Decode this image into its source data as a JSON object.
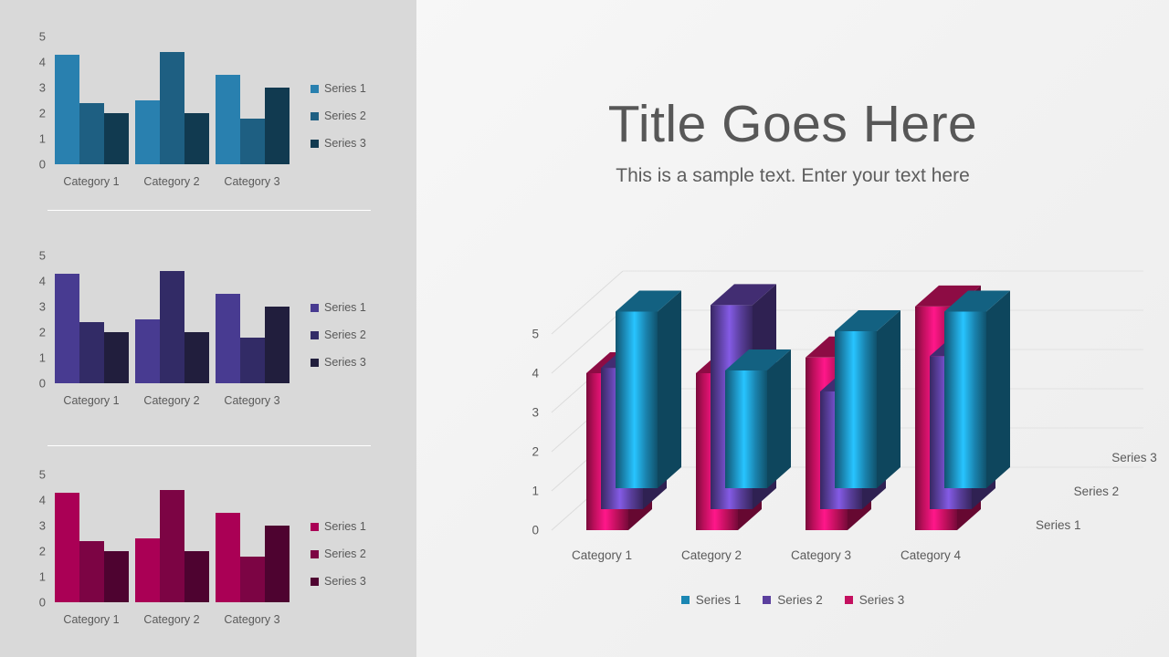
{
  "header": {
    "title": "Title Goes Here",
    "subtitle": "This is a sample text. Enter your text here"
  },
  "mini_charts": [
    {
      "id": "mini-chart-1",
      "palette": [
        "#2980af",
        "#1e5f82",
        "#113a50"
      ],
      "chart_data": {
        "type": "bar",
        "title": "",
        "xlabel": "",
        "ylabel": "",
        "ylim": [
          0,
          5
        ],
        "yticks": [
          "5",
          "4",
          "3",
          "2",
          "1",
          "0"
        ],
        "grid": false,
        "legend_position": "right",
        "categories": [
          "Category 1",
          "Category 2",
          "Category 3"
        ],
        "series": [
          {
            "name": "Series 1",
            "color": "#2980af",
            "values": [
              4.3,
              2.5,
              3.5
            ]
          },
          {
            "name": "Series 2",
            "color": "#1e5f82",
            "values": [
              2.4,
              4.4,
              1.8
            ]
          },
          {
            "name": "Series 3",
            "color": "#113a50",
            "values": [
              2.0,
              2.0,
              3.0
            ]
          }
        ]
      }
    },
    {
      "id": "mini-chart-2",
      "palette": [
        "#483b91",
        "#322b66",
        "#211e3d"
      ],
      "chart_data": {
        "type": "bar",
        "title": "",
        "xlabel": "",
        "ylabel": "",
        "ylim": [
          0,
          5
        ],
        "yticks": [
          "5",
          "4",
          "3",
          "2",
          "1",
          "0"
        ],
        "grid": false,
        "legend_position": "right",
        "categories": [
          "Category 1",
          "Category 2",
          "Category 3"
        ],
        "series": [
          {
            "name": "Series 1",
            "color": "#483b91",
            "values": [
              4.3,
              2.5,
              3.5
            ]
          },
          {
            "name": "Series 2",
            "color": "#322b66",
            "values": [
              2.4,
              4.4,
              1.8
            ]
          },
          {
            "name": "Series 3",
            "color": "#211e3d",
            "values": [
              2.0,
              2.0,
              3.0
            ]
          }
        ]
      }
    },
    {
      "id": "mini-chart-3",
      "palette": [
        "#aa0055",
        "#7c0444",
        "#4e0330"
      ],
      "chart_data": {
        "type": "bar",
        "title": "",
        "xlabel": "",
        "ylabel": "",
        "ylim": [
          0,
          5
        ],
        "yticks": [
          "5",
          "4",
          "3",
          "2",
          "1",
          "0"
        ],
        "grid": false,
        "legend_position": "right",
        "categories": [
          "Category 1",
          "Category 2",
          "Category 3"
        ],
        "series": [
          {
            "name": "Series 1",
            "color": "#aa0055",
            "values": [
              4.3,
              2.5,
              3.5
            ]
          },
          {
            "name": "Series 2",
            "color": "#7c0444",
            "values": [
              2.4,
              4.4,
              1.8
            ]
          },
          {
            "name": "Series 3",
            "color": "#4e0330",
            "values": [
              2.0,
              2.0,
              3.0
            ]
          }
        ]
      }
    }
  ],
  "chart_data": {
    "type": "bar",
    "render": "3d-column",
    "title": "",
    "xlabel": "",
    "ylabel": "",
    "ylim": [
      0,
      5
    ],
    "yticks": [
      "5",
      "4",
      "3",
      "2",
      "1",
      "0"
    ],
    "grid": true,
    "legend_position": "bottom",
    "depth_axis_labels": [
      "Series 1",
      "Series 2",
      "Series 3"
    ],
    "categories": [
      "Category 1",
      "Category 2",
      "Category 3",
      "Category 4"
    ],
    "series": [
      {
        "name": "Series 1",
        "color": "#1b87b3",
        "values": [
          4.5,
          3.0,
          4.0,
          4.5
        ]
      },
      {
        "name": "Series 2",
        "color": "#5b3f9e",
        "values": [
          3.6,
          5.2,
          3.0,
          3.9
        ]
      },
      {
        "name": "Series 3",
        "color": "#c4105f",
        "values": [
          4.0,
          4.0,
          4.4,
          5.7
        ]
      }
    ]
  },
  "legend3d": [
    {
      "label": "Series 1",
      "color": "#1b87b3"
    },
    {
      "label": "Series 2",
      "color": "#5b3f9e"
    },
    {
      "label": "Series 3",
      "color": "#c4105f"
    }
  ]
}
